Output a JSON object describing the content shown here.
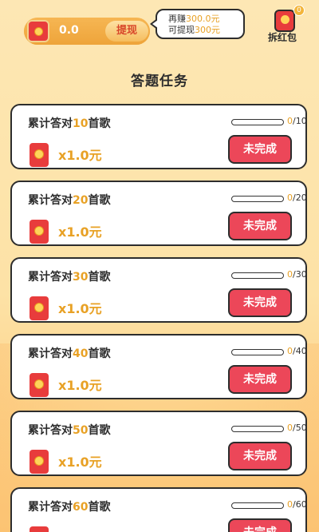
{
  "header": {
    "balance": "0.0",
    "withdraw_label": "提现",
    "bubble_prefix_1": "再赚",
    "bubble_value_1": "300.0元",
    "bubble_prefix_2": "可提现",
    "bubble_value_2": "300元",
    "open_packet_label": "拆红包",
    "badge": "0"
  },
  "section_title": "答题任务",
  "tasks": [
    {
      "prefix": "累计答对",
      "count": "10",
      "suffix": "首歌",
      "reward": "x1.0元",
      "progress_cur": "0",
      "progress_total": "/10",
      "progress": 0,
      "status": "未完成"
    },
    {
      "prefix": "累计答对",
      "count": "20",
      "suffix": "首歌",
      "reward": "x1.0元",
      "progress_cur": "0",
      "progress_total": "/20",
      "progress": 0,
      "status": "未完成"
    },
    {
      "prefix": "累计答对",
      "count": "30",
      "suffix": "首歌",
      "reward": "x1.0元",
      "progress_cur": "0",
      "progress_total": "/30",
      "progress": 0,
      "status": "未完成"
    },
    {
      "prefix": "累计答对",
      "count": "40",
      "suffix": "首歌",
      "reward": "x1.0元",
      "progress_cur": "0",
      "progress_total": "/40",
      "progress": 0,
      "status": "未完成"
    },
    {
      "prefix": "累计答对",
      "count": "50",
      "suffix": "首歌",
      "reward": "x1.0元",
      "progress_cur": "0",
      "progress_total": "/50",
      "progress": 0,
      "status": "未完成"
    },
    {
      "prefix": "累计答对",
      "count": "60",
      "suffix": "首歌",
      "reward": "x1.0元",
      "progress_cur": "0",
      "progress_total": "/60",
      "progress": 0,
      "status": "未完成"
    }
  ]
}
